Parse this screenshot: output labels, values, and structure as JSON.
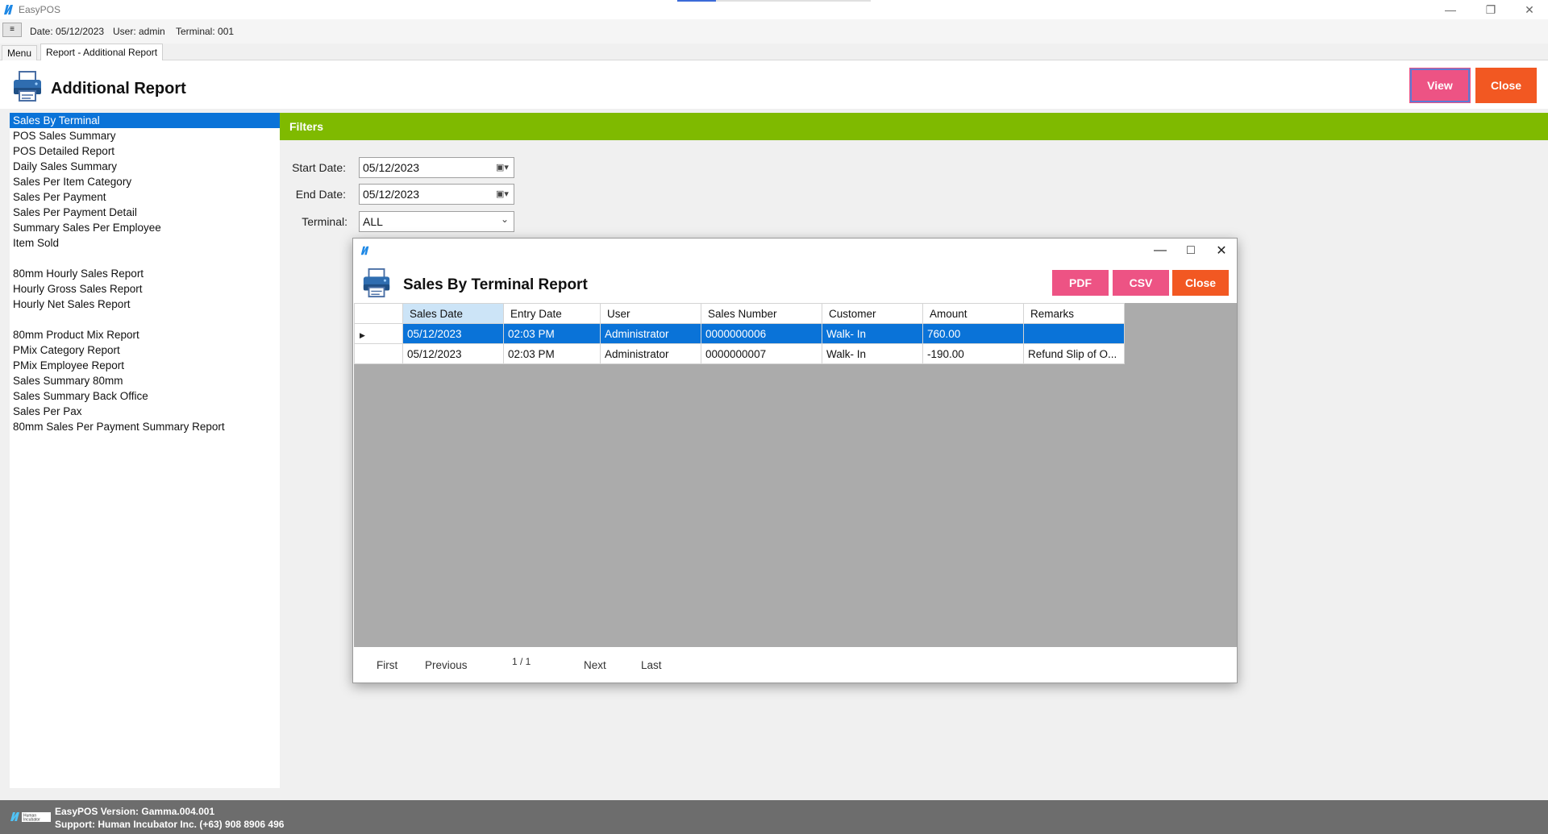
{
  "app": {
    "title": "EasyPOS",
    "minimize_glyph": "—",
    "restore_glyph": "❐",
    "close_glyph": "✕"
  },
  "status": {
    "menu_glyph": "≡",
    "date": "Date: 05/12/2023",
    "user": "User: admin",
    "terminal": "Terminal: 001"
  },
  "tabs": [
    {
      "label": "Menu"
    },
    {
      "label": "Report - Additional Report"
    }
  ],
  "header": {
    "title": "Additional Report",
    "view_label": "View",
    "close_label": "Close"
  },
  "reports": [
    {
      "label": "Sales By Terminal",
      "selected": true
    },
    {
      "label": "POS Sales Summary"
    },
    {
      "label": "POS Detailed Report"
    },
    {
      "label": "Daily Sales Summary"
    },
    {
      "label": "Sales Per Item Category"
    },
    {
      "label": "Sales Per Payment"
    },
    {
      "label": "Sales Per Payment Detail"
    },
    {
      "label": "Summary Sales Per Employee"
    },
    {
      "label": "Item Sold"
    },
    {
      "label": ""
    },
    {
      "label": "80mm Hourly Sales Report"
    },
    {
      "label": "Hourly Gross Sales Report"
    },
    {
      "label": "Hourly Net Sales Report"
    },
    {
      "label": ""
    },
    {
      "label": "80mm Product Mix Report"
    },
    {
      "label": "PMix Category Report"
    },
    {
      "label": "PMix Employee Report"
    },
    {
      "label": "Sales Summary 80mm"
    },
    {
      "label": "Sales Summary Back Office"
    },
    {
      "label": "Sales Per Pax"
    },
    {
      "label": "80mm Sales Per Payment Summary Report"
    }
  ],
  "filters": {
    "title": "Filters",
    "start_date_label": "Start Date:",
    "start_date_value": "05/12/2023",
    "end_date_label": "End Date:",
    "end_date_value": "05/12/2023",
    "terminal_label": "Terminal:",
    "terminal_value": "ALL"
  },
  "dialog": {
    "title": "Sales By Terminal Report",
    "pdf_label": "PDF",
    "csv_label": "CSV",
    "close_label": "Close",
    "minimize_glyph": "—",
    "maximize_glyph": "□",
    "close_glyph": "✕",
    "columns": [
      "Sales Date",
      "Entry Date",
      "User",
      "Sales Number",
      "Customer",
      "Amount",
      "Remarks"
    ],
    "rows": [
      {
        "sales_date": "05/12/2023",
        "entry_date": "02:03 PM",
        "user": "Administrator",
        "sales_number": "0000000006",
        "customer": "Walk- In",
        "amount": "760.00",
        "remarks": "",
        "selected": true
      },
      {
        "sales_date": "05/12/2023",
        "entry_date": "02:03 PM",
        "user": "Administrator",
        "sales_number": "0000000007",
        "customer": "Walk- In",
        "amount": "-190.00",
        "remarks": "Refund Slip of O..."
      }
    ],
    "pager": {
      "first": "First",
      "previous": "Previous",
      "page_info": "1 / 1",
      "next": "Next",
      "last": "Last"
    }
  },
  "footer": {
    "version": "EasyPOS Version: Gamma.004.001",
    "support": "Support: Human Incubator Inc. (+63) 908 8906 496",
    "logo_text": "Human Incubator"
  },
  "colors": {
    "accent_blue": "#0a73d8",
    "filters_green": "#7fba00",
    "pink_button": "#ed5384",
    "orange_button": "#f25822",
    "footer_gray": "#6d6d6d"
  }
}
